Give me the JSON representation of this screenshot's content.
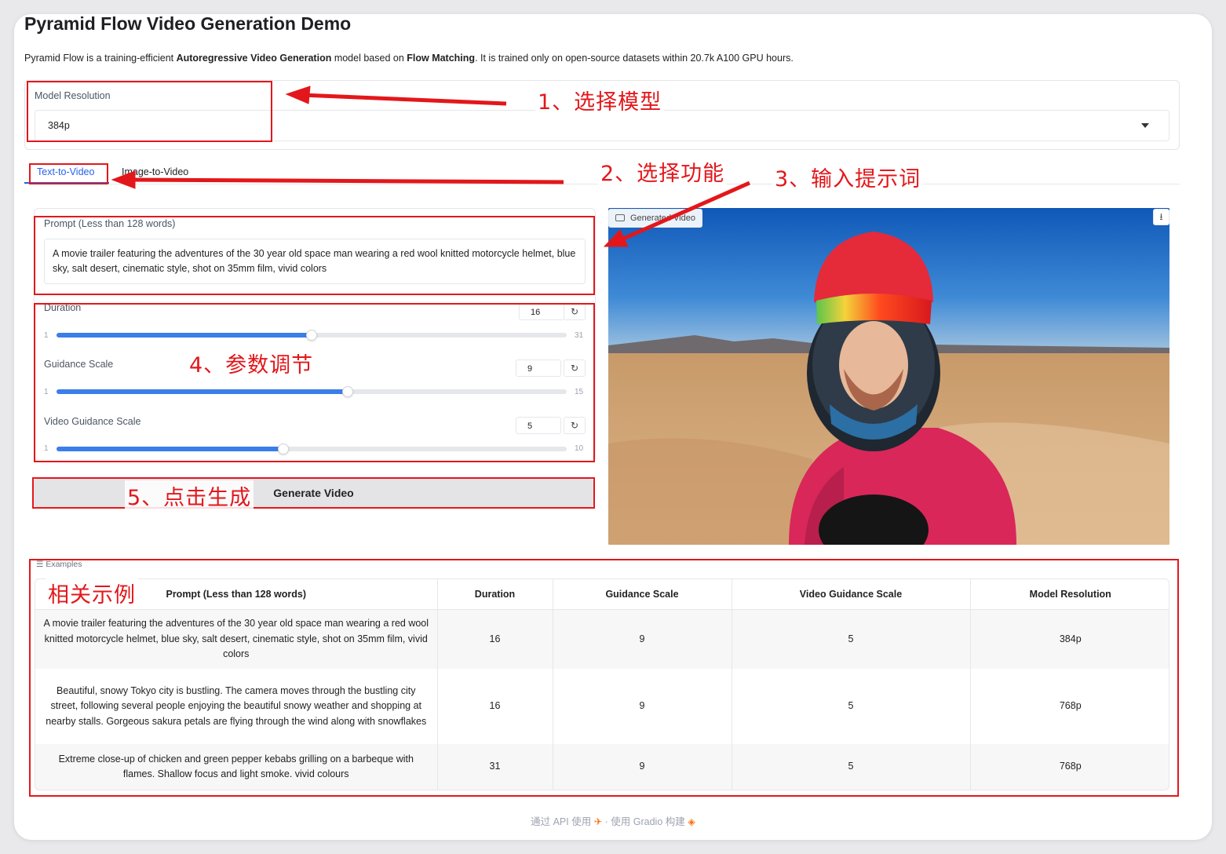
{
  "app": {
    "title": "Pyramid Flow Video Generation Demo",
    "subtitle_parts": {
      "p1": "Pyramid Flow is a training-efficient ",
      "b1": "Autoregressive Video Generation",
      "p2": " model based on ",
      "b2": "Flow Matching",
      "p3": ". It is trained only on open-source datasets within 20.7k A100 GPU hours."
    }
  },
  "model_resolution": {
    "label": "Model Resolution",
    "value": "384p"
  },
  "tabs": [
    {
      "label": "Text-to-Video",
      "active": true
    },
    {
      "label": "Image-to-Video",
      "active": false
    }
  ],
  "prompt": {
    "label": "Prompt (Less than 128 words)",
    "value": "A movie trailer featuring the adventures of the 30 year old space man wearing a red wool knitted motorcycle helmet, blue sky, salt desert, cinematic style, shot on 35mm film, vivid colors"
  },
  "sliders": {
    "duration": {
      "label": "Duration",
      "value": 16,
      "min": 1,
      "max": 31,
      "value_text": "16",
      "min_text": "1",
      "max_text": "31"
    },
    "guidance": {
      "label": "Guidance Scale",
      "value": 9,
      "min": 1,
      "max": 15,
      "value_text": "9",
      "min_text": "1",
      "max_text": "15"
    },
    "video_guidance": {
      "label": "Video Guidance Scale",
      "value": 5,
      "min": 1,
      "max": 10,
      "value_text": "5",
      "min_text": "1",
      "max_text": "10"
    }
  },
  "generate_button": {
    "label": "Generate Video"
  },
  "video": {
    "badge_label": "Generated Video"
  },
  "examples": {
    "label": "Examples",
    "columns": [
      "Prompt (Less than 128 words)",
      "Duration",
      "Guidance Scale",
      "Video Guidance Scale",
      "Model Resolution"
    ],
    "rows": [
      [
        "A movie trailer featuring the adventures of the 30 year old space man wearing a red wool knitted motorcycle helmet, blue sky, salt desert, cinematic style, shot on 35mm film, vivid colors",
        "16",
        "9",
        "5",
        "384p"
      ],
      [
        "Beautiful, snowy Tokyo city is bustling. The camera moves through the bustling city street, following several people enjoying the beautiful snowy weather and shopping at nearby stalls. Gorgeous sakura petals are flying through the wind along with snowflakes",
        "16",
        "9",
        "5",
        "768p"
      ],
      [
        "Extreme close-up of chicken and green pepper kebabs grilling on a barbeque with flames. Shallow focus and light smoke. vivid colours",
        "31",
        "9",
        "5",
        "768p"
      ]
    ]
  },
  "footer": {
    "api": "通过 API 使用",
    "sep": "·",
    "built": "使用 Gradio 构建"
  },
  "annotations": {
    "a1": "1、选择模型",
    "a2": "2、选择功能",
    "a3": "3、输入提示词",
    "a4": "4、参数调节",
    "a5": "5、点击生成",
    "a6": "相关示例"
  },
  "colors": {
    "accent": "#2563eb",
    "slider_fill": "#3b7de9",
    "annotation": "#e3171b"
  }
}
